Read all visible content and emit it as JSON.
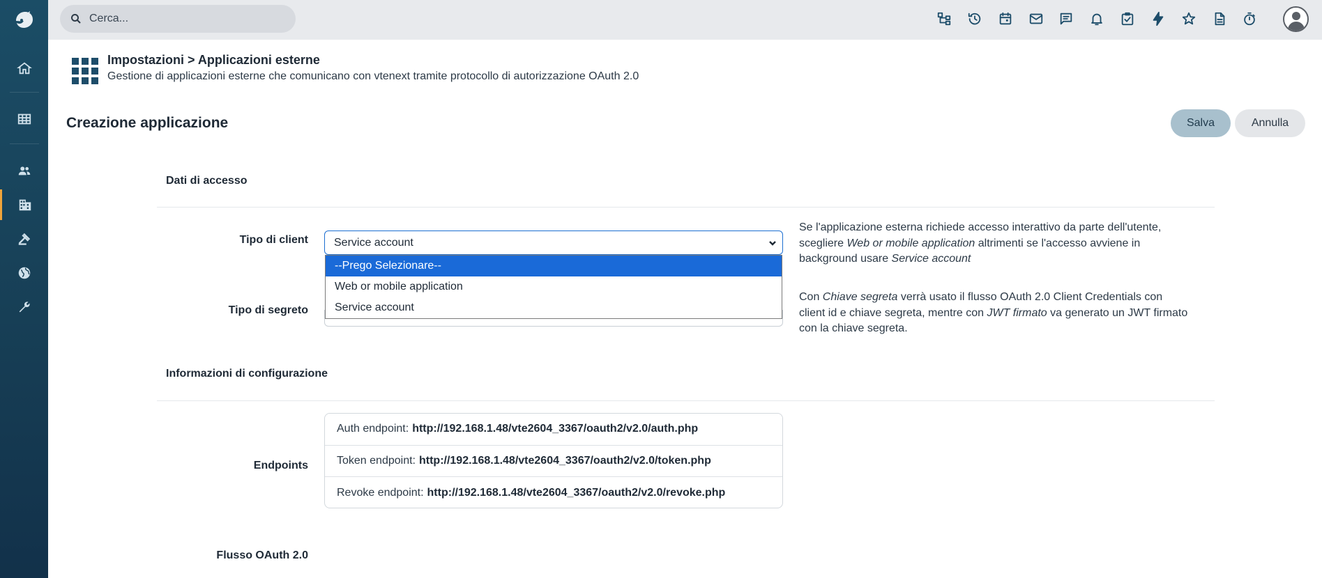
{
  "topbar": {
    "search_placeholder": "Cerca...",
    "icons": [
      "sitemap-icon",
      "history-icon",
      "calendar-icon",
      "mail-icon",
      "chat-icon",
      "bell-icon",
      "task-check-icon",
      "bolt-icon",
      "star-icon",
      "document-icon",
      "stopwatch-icon"
    ]
  },
  "sidebar": {
    "items": [
      "home-icon",
      "grid-icon",
      "people-icon",
      "building-icon",
      "gavel-icon",
      "globe-icon",
      "wrench-icon"
    ],
    "active": "building-icon",
    "accent": "#f0a43a"
  },
  "header": {
    "breadcrumb": "Impostazioni > Applicazioni esterne",
    "subtitle": "Gestione di applicazioni esterne che comunicano con vtenext tramite protocollo di autorizzazione OAuth 2.0"
  },
  "page": {
    "title": "Creazione applicazione",
    "save_label": "Salva",
    "cancel_label": "Annulla"
  },
  "form": {
    "section_access": "Dati di accesso",
    "client_type_label": "Tipo di client",
    "client_type_value": "Service account",
    "client_type_options": [
      "--Prego Selezionare--",
      "Web or mobile application",
      "Service account"
    ],
    "client_type_help_1": "Se l'applicazione esterna richiede accesso interattivo da parte dell'utente, scegliere ",
    "client_type_help_em1": "Web or mobile application",
    "client_type_help_2": " altrimenti se l'accesso avviene in background usare ",
    "client_type_help_em2": "Service account",
    "secret_type_label": "Tipo di segreto",
    "secret_help_1": "Con ",
    "secret_help_em1": "Chiave segreta",
    "secret_help_2": " verrà usato il flusso OAuth 2.0 Client Credentials con client id e chiave segreta, mentre con ",
    "secret_help_em2": "JWT firmato",
    "secret_help_3": " va generato un JWT firmato con la chiave segreta.",
    "section_config": "Informazioni di configurazione",
    "endpoints_label": "Endpoints",
    "endpoints": [
      {
        "label": "Auth endpoint:",
        "url": "http://192.168.1.48/vte2604_3367/oauth2/v2.0/auth.php"
      },
      {
        "label": "Token endpoint:",
        "url": "http://192.168.1.48/vte2604_3367/oauth2/v2.0/token.php"
      },
      {
        "label": "Revoke endpoint:",
        "url": "http://192.168.1.48/vte2604_3367/oauth2/v2.0/revoke.php"
      }
    ],
    "flow_label": "Flusso OAuth 2.0"
  }
}
